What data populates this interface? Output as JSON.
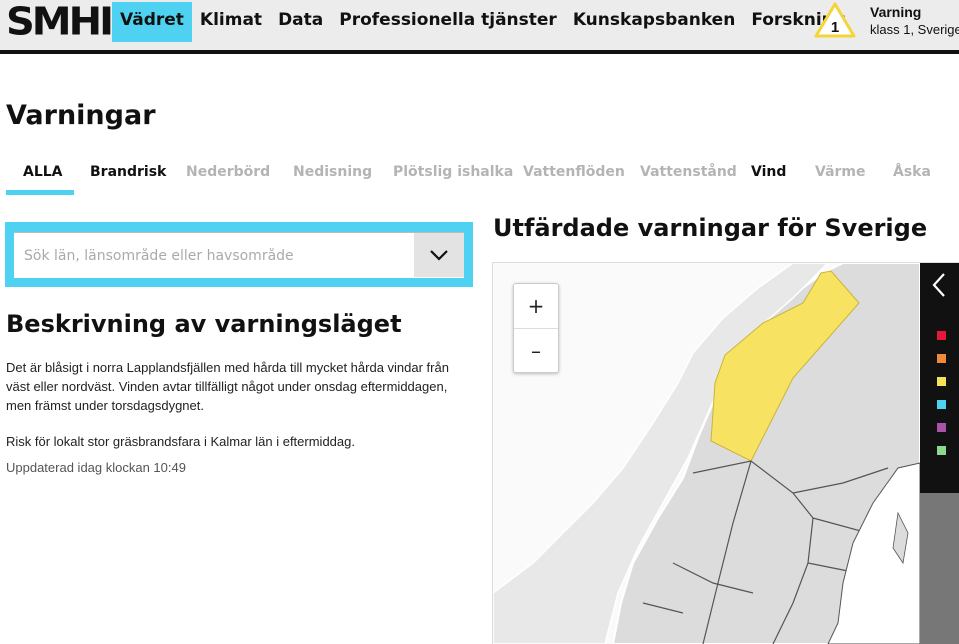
{
  "header": {
    "logo": "SMHI",
    "nav": [
      {
        "label": "Vädret",
        "active": true
      },
      {
        "label": "Klimat",
        "active": false
      },
      {
        "label": "Data",
        "active": false
      },
      {
        "label": "Professionella tjänster",
        "active": false
      },
      {
        "label": "Kunskapsbanken",
        "active": false
      },
      {
        "label": "Forskning",
        "active": false
      }
    ],
    "warning": {
      "count": "1",
      "title": "Varning",
      "subtitle": "klass 1, Sverige"
    }
  },
  "page": {
    "title": "Varningar",
    "tabs": [
      "ALLA",
      "Brandrisk",
      "Nederbörd",
      "Nedisning",
      "Plötslig ishalka",
      "Vattenflöden",
      "Vattenstånd",
      "Vind",
      "Värme",
      "Åska"
    ],
    "active_tab": "ALLA"
  },
  "search": {
    "placeholder": "Sök län, länsområde eller havsområde"
  },
  "description": {
    "title": "Beskrivning av varningsläget",
    "paragraphs": [
      "Det är blåsigt i norra Lapplandsfjällen med hårda till mycket hårda vindar från väst eller nordväst. Vinden avtar tillfälligt något under onsdag eftermiddagen, men främst under torsdagsdygnet.",
      "Risk för lokalt stor gräsbrandsfara i Kalmar län i eftermiddag."
    ],
    "updated": "Uppdaterad idag klockan 10:49"
  },
  "map": {
    "title": "Utfärdade varningar för Sverige",
    "zoom_in": "+",
    "zoom_out": "–",
    "legend_colors": [
      "#e8173a",
      "#f08a3a",
      "#f7e05a",
      "#4fd2f2",
      "#a855a8",
      "#8fd68f"
    ],
    "warning_area_color": "#f7e361",
    "land_color": "#dcdcdc"
  },
  "colors": {
    "accent": "#4fd2f2"
  }
}
